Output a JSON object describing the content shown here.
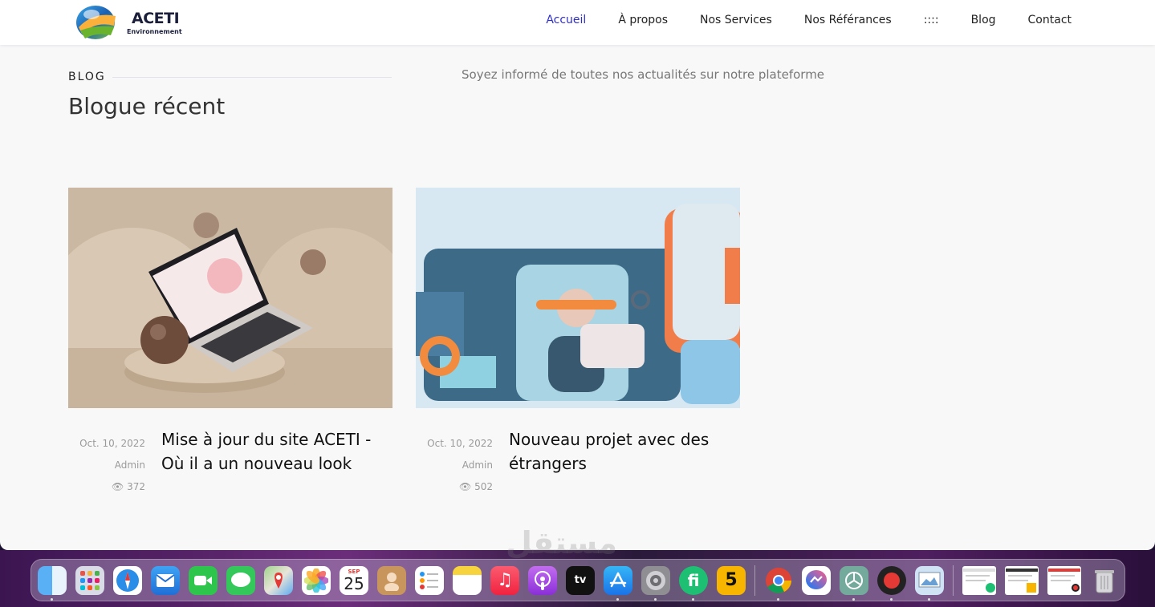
{
  "header": {
    "logo_text": "ACETI",
    "logo_sub": "Environnement",
    "nav": [
      "Accueil",
      "À propos",
      "Nos Services",
      "Nos Référances",
      "::::",
      "Blog",
      "Contact"
    ]
  },
  "section": {
    "label": "BLOG",
    "title": "Blogue récent",
    "subtitle": "Soyez informé de toutes nos actualités sur notre plateforme"
  },
  "posts": [
    {
      "date": "Oct. 10, 2022",
      "author": "Admin",
      "views": "372",
      "title": "Mise à jour du site ACETI - Où il a un nouveau look"
    },
    {
      "date": "Oct. 10, 2022",
      "author": "Admin",
      "views": "502",
      "title": "Nouveau projet avec des étrangers"
    }
  ],
  "dock": {
    "calendar_month": "SEP",
    "calendar_day": "25",
    "tv_label": "tv",
    "badge_5": "5",
    "app_fi": "fi",
    "watermark": "مستقل"
  }
}
